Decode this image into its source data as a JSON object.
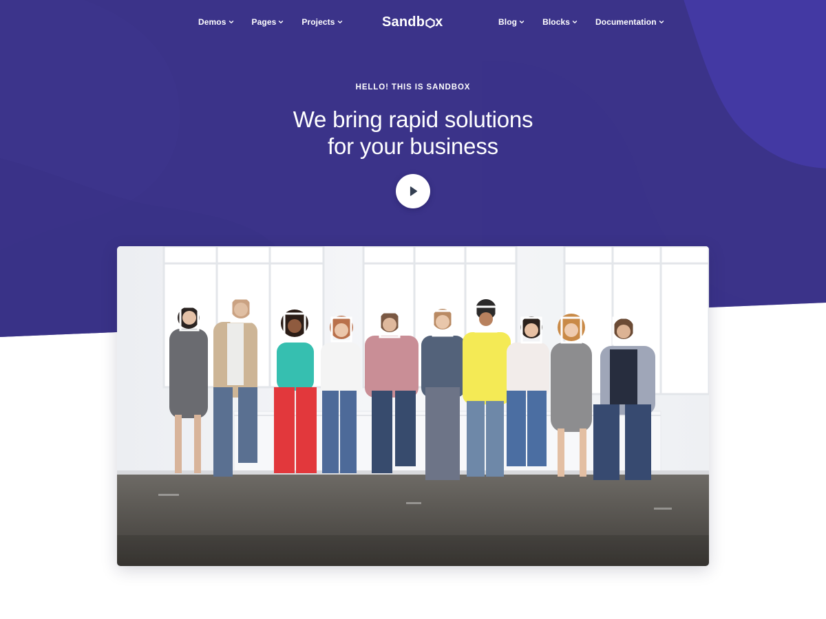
{
  "nav": {
    "left": [
      {
        "label": "Demos"
      },
      {
        "label": "Pages"
      },
      {
        "label": "Projects"
      }
    ],
    "right": [
      {
        "label": "Blog"
      },
      {
        "label": "Blocks"
      },
      {
        "label": "Documentation"
      }
    ]
  },
  "logo": {
    "text_before": "Sandb",
    "text_after": "x"
  },
  "hero": {
    "eyebrow": "HELLO! THIS IS SANDBOX",
    "headline_line1": "We bring rapid solutions",
    "headline_line2": "for your business"
  },
  "colors": {
    "hero_bg": "#3b3389",
    "hero_bg_light": "#4238a0",
    "blob": "#3d358e",
    "text_on_dark": "#ffffff",
    "play_icon": "#343f52"
  },
  "icons": {
    "play": "play-icon",
    "chevron": "chevron-down-icon",
    "logo_mark": "hexagon-icon"
  },
  "media": {
    "photo": "group-of-people-holding-frames-photo"
  }
}
